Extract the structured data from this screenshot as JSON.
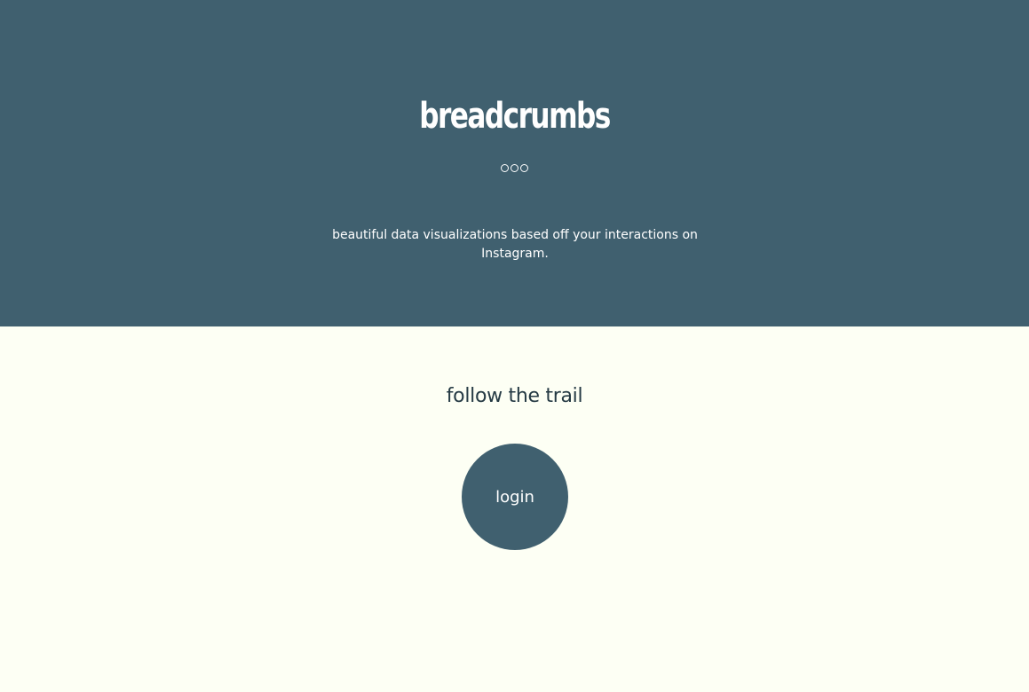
{
  "hero": {
    "logo_text": "breadcrumbs",
    "dots_icon": "three-circles-icon",
    "tagline": "beautiful data visualizations based off your interactions on Instagram."
  },
  "cta": {
    "heading": "follow the trail",
    "login_label": "login"
  },
  "colors": {
    "hero_background": "#40606f",
    "page_background": "#fdfff4",
    "button_background": "#40606f",
    "heading_text": "#253a44"
  }
}
